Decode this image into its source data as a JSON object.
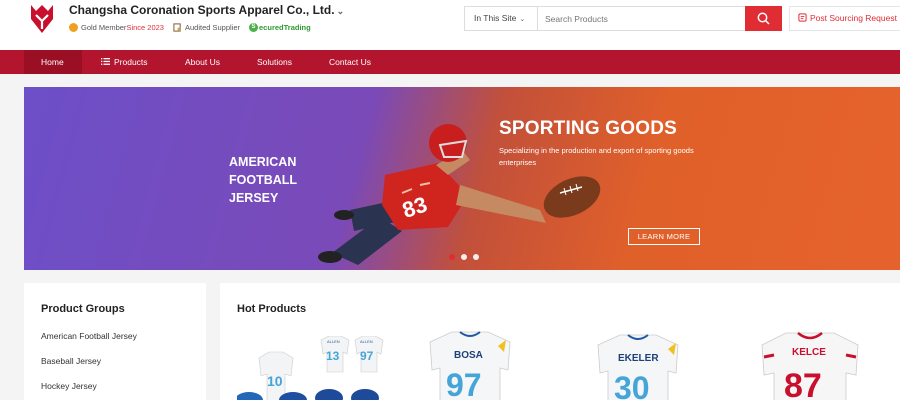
{
  "header": {
    "company_name": "Changsha Coronation Sports Apparel Co., Ltd.",
    "badges": {
      "gold_member": "Gold Member",
      "since": "Since 2023",
      "audited": "Audited Supplier",
      "secured_prefix": "S",
      "secured_rest": "ecuredTrading"
    },
    "search": {
      "scope": "In This Site",
      "placeholder": "Search Products"
    },
    "post_sourcing": "Post Sourcing Request"
  },
  "nav": {
    "home": "Home",
    "products": "Products",
    "about": "About Us",
    "solutions": "Solutions",
    "contact": "Contact Us"
  },
  "banner": {
    "sub_title_line1": "AMERICAN",
    "sub_title_line2": "FOOTBALL JERSEY",
    "title": "SPORTING GOODS",
    "desc": "Specializing in the production and export of sporting goods enterprises",
    "cta": "LEARN MORE",
    "slides": 3,
    "active_slide": 1
  },
  "product_groups": {
    "title": "Product Groups",
    "items": [
      "American Football Jersey",
      "Baseball Jersey",
      "Hockey Jersey"
    ]
  },
  "hot_products": {
    "title": "Hot Products",
    "items": [
      {
        "name_on_jersey": "",
        "numbers": [
          "10",
          "13",
          "97"
        ],
        "names": [
          "ALLEN",
          "ALLEN"
        ]
      },
      {
        "name_on_jersey": "BOSA",
        "number": "97"
      },
      {
        "name_on_jersey": "EKELER",
        "number": "30"
      },
      {
        "name_on_jersey": "KELCE",
        "number": "87"
      }
    ]
  },
  "colors": {
    "brand_red": "#b3152e",
    "accent_red": "#e02c33",
    "banner_purple": "#6d4fc8",
    "banner_orange": "#e6622c"
  }
}
